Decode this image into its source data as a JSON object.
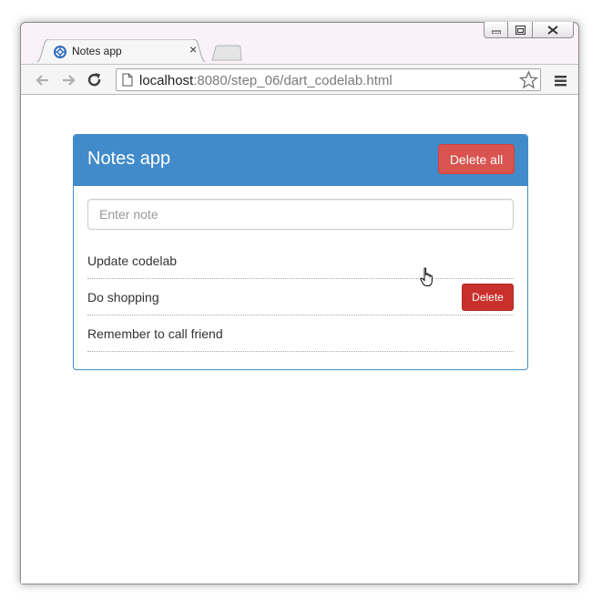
{
  "browser": {
    "tab_title": "Notes app",
    "tab_close": "×",
    "url_host": "localhost",
    "url_rest": ":8080/step_06/dart_codelab.html"
  },
  "app": {
    "title": "Notes app",
    "delete_all_label": "Delete all",
    "input_placeholder": "Enter note",
    "delete_label": "Delete",
    "notes": [
      "Update codelab",
      "Do shopping",
      "Remember to call friend"
    ]
  },
  "colors": {
    "panel_primary": "#428bca",
    "danger": "#d9534f",
    "danger_hover": "#c9302c"
  }
}
